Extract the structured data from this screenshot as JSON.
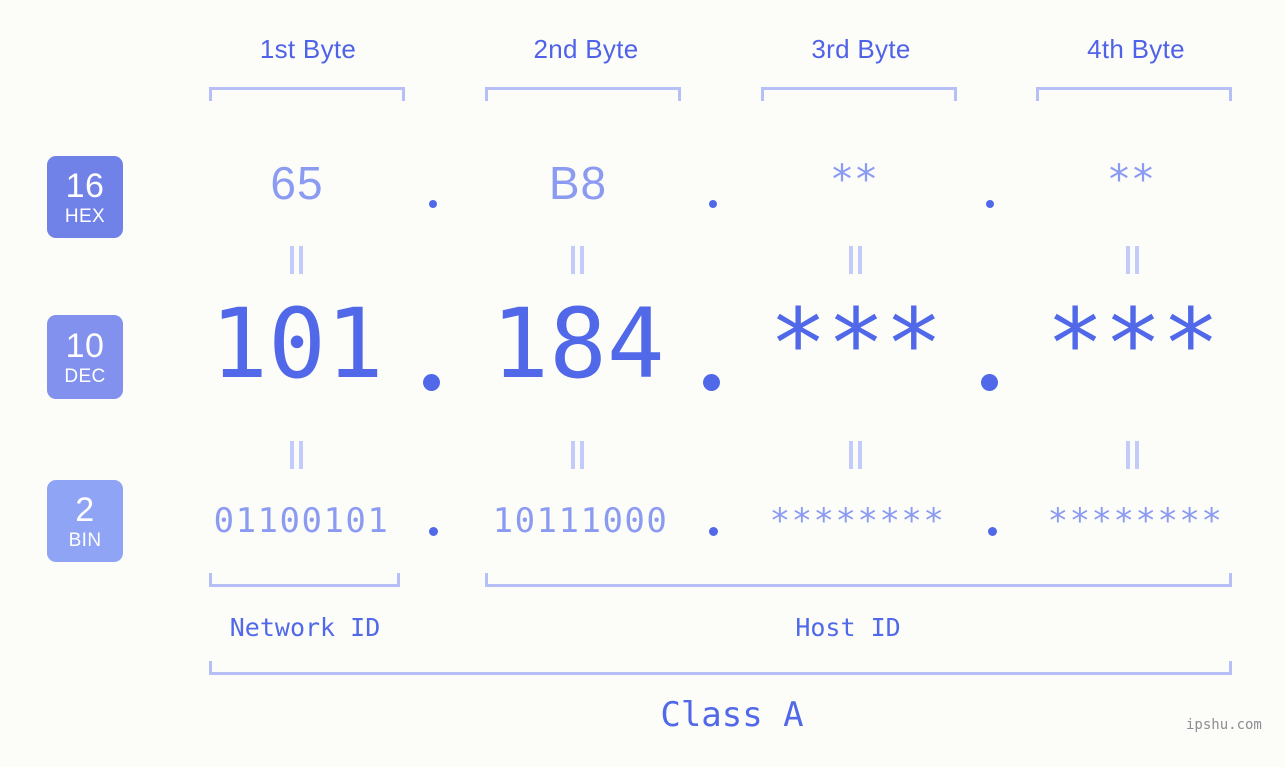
{
  "background_color": "#fcfdf9",
  "accent_colors": {
    "strong": "#5169e8",
    "medium": "#8b9bf2",
    "light": "#b6c0f7",
    "bracket": "#b6c0f7",
    "badge_hex": "#7081e8",
    "badge_dec": "#8290ee",
    "badge_bin": "#8fa4f5",
    "watermark": "#8d8d93"
  },
  "header": {
    "byte_labels": [
      "1st Byte",
      "2nd Byte",
      "3rd Byte",
      "4th Byte"
    ]
  },
  "radix_badges": [
    {
      "number": "16",
      "abbr": "HEX",
      "color": "#7081e8"
    },
    {
      "number": "10",
      "abbr": "DEC",
      "color": "#8290ee"
    },
    {
      "number": "2",
      "abbr": "BIN",
      "color": "#8fa4f5"
    }
  ],
  "rows": {
    "hex": {
      "radix": "16",
      "name": "HEX",
      "bytes": [
        "65",
        "B8",
        "**",
        "**"
      ],
      "separator": "."
    },
    "dec": {
      "radix": "10",
      "name": "DEC",
      "bytes": [
        "101",
        "184",
        "***",
        "***"
      ],
      "separator": "."
    },
    "bin": {
      "radix": "2",
      "name": "BIN",
      "bytes": [
        "01100101",
        "10111000",
        "********",
        "********"
      ],
      "separator": "."
    }
  },
  "equals_marks": {
    "glyph": "=",
    "count_per_row_gap": 4,
    "description": "rotated equals sign shown as two vertical bars"
  },
  "footer": {
    "network_id_label": "Network ID",
    "host_id_label": "Host ID",
    "class_label": "Class A"
  },
  "watermark": {
    "text": "ipshu.com"
  }
}
